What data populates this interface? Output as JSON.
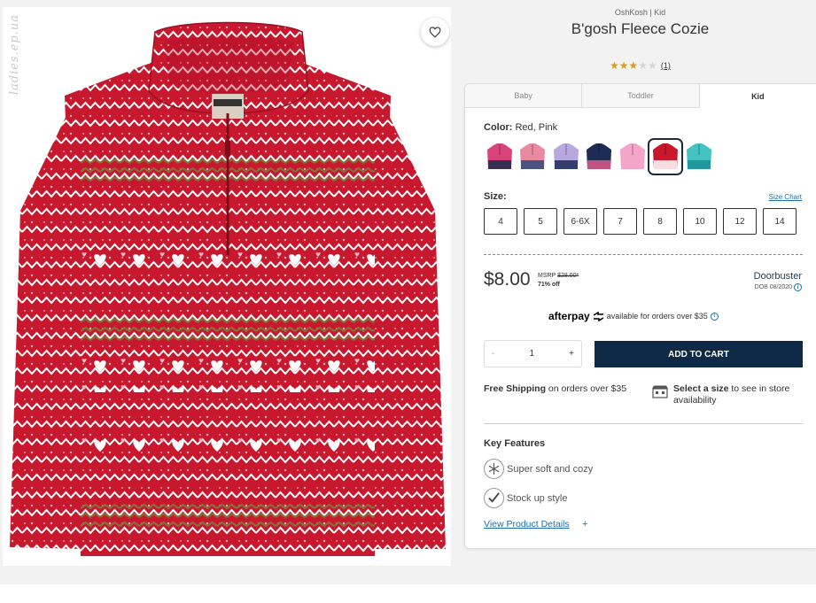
{
  "watermark": "ladies.ep.ua",
  "product": {
    "brand_line": "OshKosh | Kid",
    "title": "B'gosh Fleece Cozie",
    "rating_value": 3,
    "rating_max": 5,
    "review_count": "(1)"
  },
  "tabs": [
    {
      "label": "Baby",
      "active": false
    },
    {
      "label": "Toddler",
      "active": false
    },
    {
      "label": "Kid",
      "active": true
    }
  ],
  "color": {
    "label": "Color:",
    "value": "Red, Pink",
    "swatches": [
      {
        "name": "pink-navy",
        "main": "#d9457a",
        "accent": "#1c2a4a",
        "selected": false
      },
      {
        "name": "stripe",
        "main": "#e98aa2",
        "accent": "#2f4a7a",
        "selected": false
      },
      {
        "name": "lavender-navy",
        "main": "#b7a8e0",
        "accent": "#1d2b5a",
        "selected": false
      },
      {
        "name": "navy-dots",
        "main": "#1d2b55",
        "accent": "#e05a8a",
        "selected": false
      },
      {
        "name": "light-pink",
        "main": "#f3a6c8",
        "accent": "#f3a6c8",
        "selected": false
      },
      {
        "name": "red-pink-fairisle",
        "main": "#c8182e",
        "accent": "#ffffff",
        "selected": true
      },
      {
        "name": "teal",
        "main": "#44c3c3",
        "accent": "#1b8f9a",
        "selected": false
      }
    ]
  },
  "size": {
    "label": "Size:",
    "chart_link": "Size Chart",
    "options": [
      "4",
      "5",
      "6-6X",
      "7",
      "8",
      "10",
      "12",
      "14"
    ]
  },
  "pricing": {
    "price": "$8.00",
    "msrp_label": "MSRP",
    "msrp_value": "$28.00*",
    "discount": "71% off",
    "deal_name": "Doorbuster",
    "deal_date": "DOB 08/2020"
  },
  "afterpay": {
    "logo": "afterpay",
    "text": "available for orders over $35"
  },
  "quantity": {
    "minus": "-",
    "value": "1",
    "plus": "+"
  },
  "cart_button": "ADD TO CART",
  "shipping": {
    "bold": "Free Shipping",
    "rest": " on orders over $35"
  },
  "store": {
    "bold": "Select a size",
    "rest": " to see in store availability"
  },
  "key_features": {
    "title": "Key Features",
    "items": [
      "Super soft and cozy",
      "Stock up style"
    ]
  },
  "details_link": "View Product Details",
  "details_plus": "+",
  "colors": {
    "sweater_red": "#c8182e",
    "cart_navy": "#0e2a47",
    "link_blue": "#1a6fa8",
    "star_gold": "#d4a017"
  }
}
